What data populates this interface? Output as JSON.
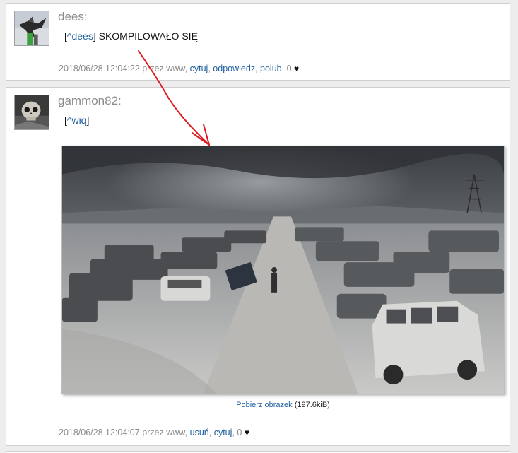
{
  "posts": [
    {
      "username": "dees:",
      "reply_ref": "^dees",
      "text": " SKOMPILOWAŁO SIĘ",
      "date": "2018/06/28 12:04:22",
      "by_label": "przez",
      "by_user": "www",
      "actions": [
        "cytuj",
        "odpowiedz",
        "polub"
      ],
      "like_count": "0"
    },
    {
      "username": "gammon82:",
      "reply_ref": "^wiq",
      "image_download_label": "Pobierz obrazek",
      "image_size": "(197.6kiB)",
      "date": "2018/06/28 12:04:07",
      "by_label": "przez",
      "by_user": "www",
      "actions": [
        "usuń",
        "cytuj"
      ],
      "like_count": "0"
    }
  ],
  "icons": {
    "heart": "heart-icon"
  },
  "colors": {
    "link": "#1f5f9e",
    "username": "#8c8c8c",
    "arrow": "#e0191e"
  }
}
